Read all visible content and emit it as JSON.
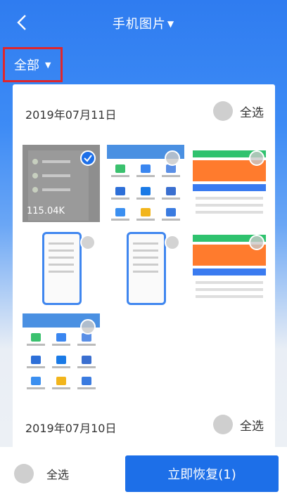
{
  "header": {
    "title": "手机图片",
    "title_arrow": "▼"
  },
  "filter": {
    "label": "全部",
    "arrow": "▼"
  },
  "groups": [
    {
      "date": "2019年07月11日",
      "select_all": "全选",
      "thumbs": [
        {
          "size": "115.04K",
          "checked": true
        },
        {
          "size": "",
          "checked": false
        },
        {
          "size": "",
          "checked": false
        },
        {
          "size": "",
          "checked": false
        },
        {
          "size": "",
          "checked": false
        },
        {
          "size": "",
          "checked": false
        },
        {
          "size": "",
          "checked": false
        }
      ]
    },
    {
      "date": "2019年07月10日",
      "select_all": "全选"
    }
  ],
  "footer": {
    "select_all": "全选",
    "restore_button": "立即恢复(1)"
  },
  "colors": {
    "primary": "#1d6fe8",
    "highlight_border": "#e0262c",
    "unchecked": "#cfcfcf"
  }
}
